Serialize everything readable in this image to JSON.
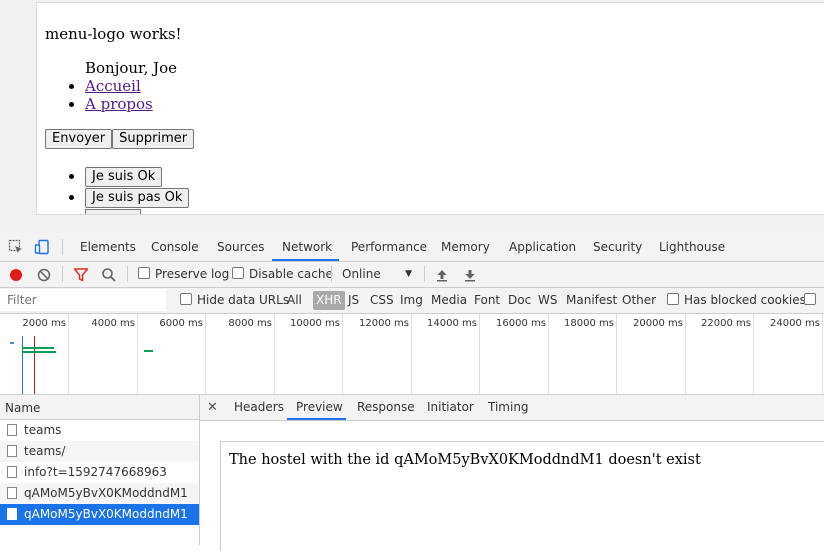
{
  "page": {
    "title": "menu-logo works!",
    "greeting": "Bonjour, Joe",
    "nav_links": [
      "Accueil",
      "A propos"
    ],
    "buttons": [
      "Envoyer",
      "Supprimer"
    ],
    "list_buttons": [
      "Je suis Ok",
      "Je suis pas Ok"
    ]
  },
  "devtools": {
    "tabs": [
      "Elements",
      "Console",
      "Sources",
      "Network",
      "Performance",
      "Memory",
      "Application",
      "Security",
      "Lighthouse"
    ],
    "active_tab": "Network",
    "toolbar": {
      "preserve_log": "Preserve log",
      "disable_cache": "Disable cache",
      "throttling": "Online"
    },
    "filter": {
      "placeholder": "Filter",
      "hide_data_urls": "Hide data URLs",
      "types": [
        "All",
        "XHR",
        "JS",
        "CSS",
        "Img",
        "Media",
        "Font",
        "Doc",
        "WS",
        "Manifest",
        "Other"
      ],
      "active_type": "XHR",
      "has_blocked_cookies": "Has blocked cookies"
    },
    "timeline": {
      "ticks": [
        "2000 ms",
        "4000 ms",
        "6000 ms",
        "8000 ms",
        "10000 ms",
        "12000 ms",
        "14000 ms",
        "16000 ms",
        "18000 ms",
        "20000 ms",
        "22000 ms",
        "24000 ms"
      ]
    },
    "requests": {
      "column_header": "Name",
      "items": [
        "teams",
        "teams/",
        "info?t=1592747668963",
        "qAMoM5yBvX0KModdndM1",
        "qAMoM5yBvX0KModdndM1"
      ],
      "selected_index": 4
    },
    "detail": {
      "tabs": [
        "Headers",
        "Preview",
        "Response",
        "Initiator",
        "Timing"
      ],
      "active_tab": "Preview",
      "preview_text": "The hostel with the id qAMoM5yBvX0KModdndM1 doesn't exist"
    },
    "colors": {
      "accent": "#1a73e8",
      "record": "#e21a1a",
      "filter_icon": "#d93025"
    }
  }
}
